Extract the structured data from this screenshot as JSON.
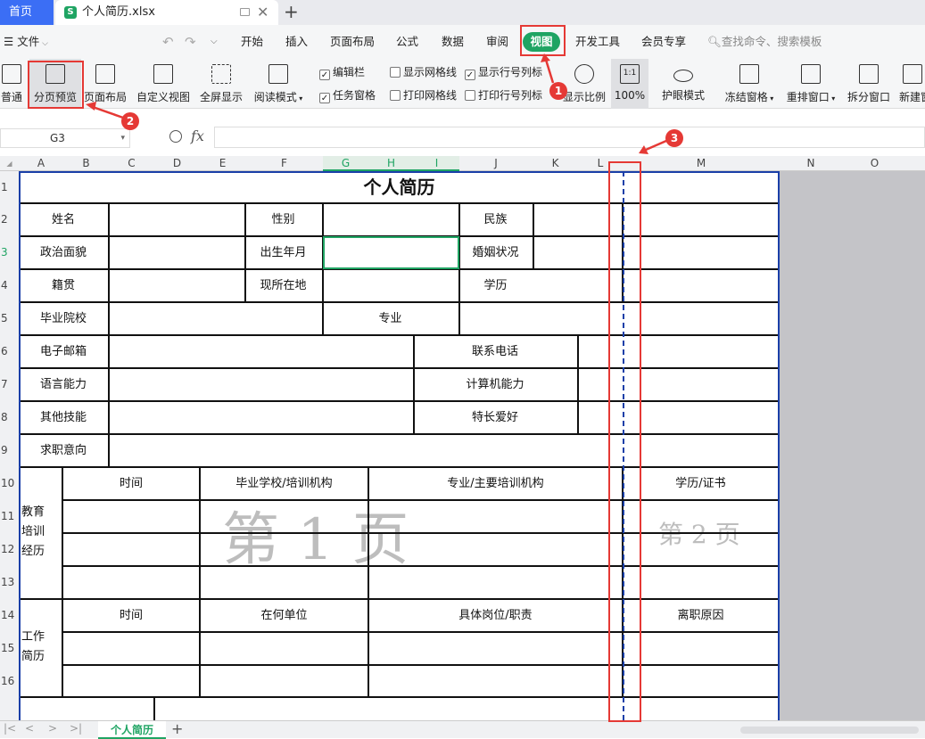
{
  "tabs": {
    "home": "首页",
    "file": "个人简历.xlsx"
  },
  "menu": {
    "file": "文件",
    "items": [
      "开始",
      "插入",
      "页面布局",
      "公式",
      "数据",
      "审阅",
      "视图",
      "开发工具",
      "会员专享"
    ],
    "search_placeholder": "查找命令、搜索模板"
  },
  "ribbon": {
    "buttons": [
      "普通",
      "分页预览",
      "页面布局",
      "自定义视图",
      "全屏显示",
      "阅读模式"
    ],
    "checks": [
      {
        "label": "编辑栏",
        "checked": true
      },
      {
        "label": "显示网格线",
        "checked": false
      },
      {
        "label": "显示行号列标",
        "checked": true
      },
      {
        "label": "任务窗格",
        "checked": true
      },
      {
        "label": "打印网格线",
        "checked": false
      },
      {
        "label": "打印行号列标",
        "checked": false
      }
    ],
    "zoom_label": "显示比例",
    "zoom_value": "100%",
    "eye": "护眼模式",
    "freeze": "冻结窗格",
    "rearrange": "重排窗口",
    "split": "拆分窗口",
    "newwin": "新建窗"
  },
  "formula_bar": {
    "cell_ref": "G3",
    "fx": "fx"
  },
  "columns": [
    "A",
    "B",
    "C",
    "D",
    "E",
    "F",
    "G",
    "H",
    "I",
    "J",
    "K",
    "L",
    "M",
    "N",
    "O"
  ],
  "rows": [
    "1",
    "2",
    "3",
    "4",
    "5",
    "6",
    "7",
    "8",
    "9",
    "10",
    "11",
    "12",
    "13",
    "14",
    "15",
    "16"
  ],
  "resume": {
    "title": "个人简历",
    "name": "姓名",
    "gender": "性别",
    "ethnicity": "民族",
    "politics": "政治面貌",
    "birth": "出生年月",
    "marital": "婚姻状况",
    "native": "籍贯",
    "residence": "现所在地",
    "education": "学历",
    "school": "毕业院校",
    "major": "专业",
    "email": "电子邮箱",
    "phone": "联系电话",
    "language": "语言能力",
    "computer": "计算机能力",
    "skills": "其他技能",
    "hobby": "特长爱好",
    "intent": "求职意向",
    "edu_section": "教育\n培训\n经历",
    "edu_time": "时间",
    "edu_school": "毕业学校/培训机构",
    "edu_major": "专业/主要培训机构",
    "edu_cert": "学历/证书",
    "work_section": "工作\n简历",
    "work_time": "时间",
    "work_unit": "在何单位",
    "work_post": "具体岗位/职责",
    "work_reason": "离职原因"
  },
  "watermarks": {
    "page1": "第 1 页",
    "page2": "第 2 页"
  },
  "sheet_tab": "个人简历",
  "badges": [
    "1",
    "2",
    "3"
  ]
}
